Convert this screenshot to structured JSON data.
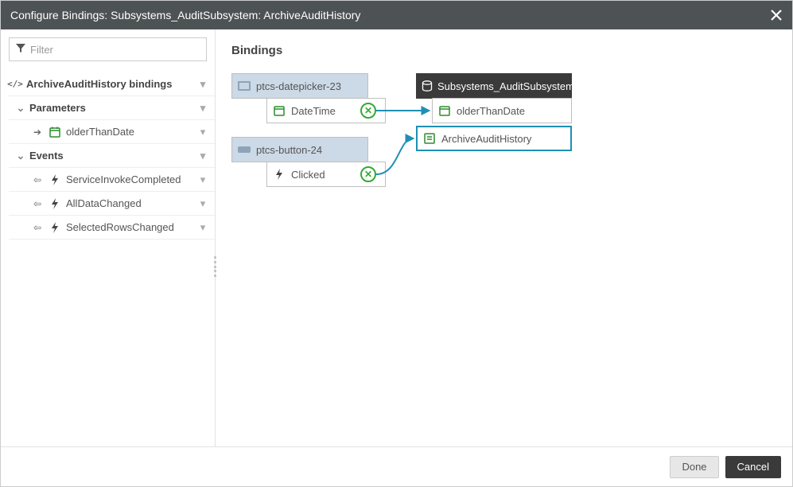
{
  "titlebar": {
    "title": "Configure Bindings: Subsystems_AuditSubsystem: ArchiveAuditHistory"
  },
  "sidebar": {
    "filter_placeholder": "Filter",
    "root_label": "ArchiveAuditHistory bindings",
    "parameters_label": "Parameters",
    "events_label": "Events",
    "params": [
      {
        "label": "olderThanDate",
        "icon": "calendar"
      }
    ],
    "events": [
      {
        "label": "ServiceInvokeCompleted"
      },
      {
        "label": "AllDataChanged"
      },
      {
        "label": "SelectedRowsChanged"
      }
    ]
  },
  "content": {
    "heading": "Bindings",
    "left": {
      "widget1": {
        "head": "ptcs-datepicker-23",
        "child": "DateTime"
      },
      "widget2": {
        "head": "ptcs-button-24",
        "child": "Clicked"
      }
    },
    "right": {
      "service_head": "Subsystems_AuditSubsystem",
      "param": "olderThanDate",
      "selected": "ArchiveAuditHistory"
    }
  },
  "footer": {
    "done": "Done",
    "cancel": "Cancel"
  }
}
